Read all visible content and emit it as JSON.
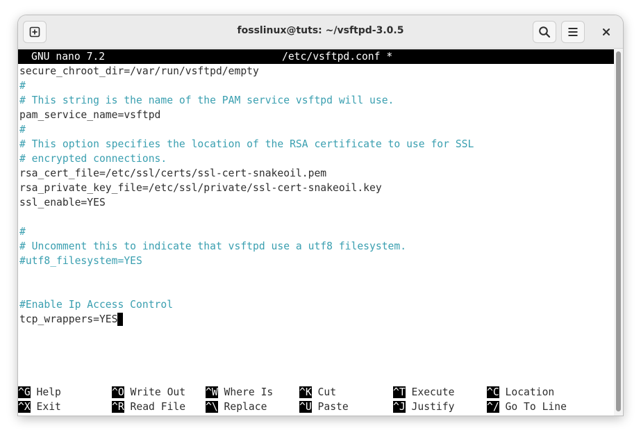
{
  "window": {
    "title": "fosslinux@tuts: ~/vsftpd-3.0.5"
  },
  "icons": {
    "new_tab": "new-tab-icon",
    "search": "search-icon",
    "menu": "hamburger-menu-icon",
    "close": "close-icon"
  },
  "nano": {
    "version": "GNU nano 7.2",
    "filename": "/etc/vsftpd.conf *"
  },
  "lines": [
    {
      "text": "secure_chroot_dir=/var/run/vsftpd/empty",
      "comment": false
    },
    {
      "text": "#",
      "comment": true
    },
    {
      "text": "# This string is the name of the PAM service vsftpd will use.",
      "comment": true
    },
    {
      "text": "pam_service_name=vsftpd",
      "comment": false
    },
    {
      "text": "#",
      "comment": true
    },
    {
      "text": "# This option specifies the location of the RSA certificate to use for SSL",
      "comment": true
    },
    {
      "text": "# encrypted connections.",
      "comment": true
    },
    {
      "text": "rsa_cert_file=/etc/ssl/certs/ssl-cert-snakeoil.pem",
      "comment": false
    },
    {
      "text": "rsa_private_key_file=/etc/ssl/private/ssl-cert-snakeoil.key",
      "comment": false
    },
    {
      "text": "ssl_enable=YES",
      "comment": false
    },
    {
      "text": "",
      "comment": false
    },
    {
      "text": "#",
      "comment": true
    },
    {
      "text": "# Uncomment this to indicate that vsftpd use a utf8 filesystem.",
      "comment": true
    },
    {
      "text": "#utf8_filesystem=YES",
      "comment": true
    },
    {
      "text": "",
      "comment": false
    },
    {
      "text": "",
      "comment": false
    },
    {
      "text": "#Enable Ip Access Control",
      "comment": true
    },
    {
      "text": "tcp_wrappers=YES",
      "comment": false
    }
  ],
  "shortcuts": [
    [
      {
        "key": "^G",
        "label": "Help"
      },
      {
        "key": "^O",
        "label": "Write Out"
      },
      {
        "key": "^W",
        "label": "Where Is"
      },
      {
        "key": "^K",
        "label": "Cut"
      },
      {
        "key": "^T",
        "label": "Execute"
      },
      {
        "key": "^C",
        "label": "Location"
      }
    ],
    [
      {
        "key": "^X",
        "label": "Exit"
      },
      {
        "key": "^R",
        "label": "Read File"
      },
      {
        "key": "^\\",
        "label": "Replace"
      },
      {
        "key": "^U",
        "label": "Paste"
      },
      {
        "key": "^J",
        "label": "Justify"
      },
      {
        "key": "^/",
        "label": "Go To Line"
      }
    ]
  ],
  "colors": {
    "comment": "#3a9fb0",
    "text": "#2e2e2e",
    "header_bg": "#000000",
    "titlebar_bg": "#ebebeb"
  }
}
